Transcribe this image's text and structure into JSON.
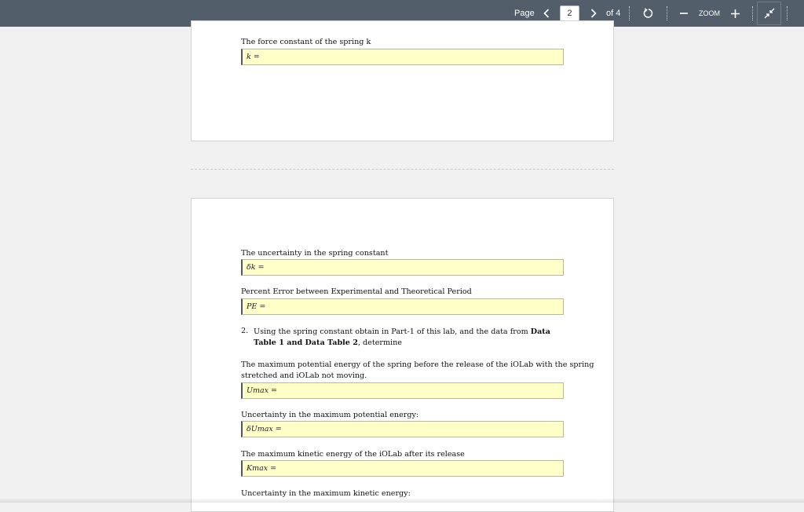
{
  "toolbar": {
    "page_label": "Page",
    "current_page": "2",
    "total_pages": "of 4",
    "zoom_label": "ZOOM",
    "icons": {
      "prev": "chevron-left-icon",
      "next": "chevron-right-icon",
      "rotate": "rotate-icon",
      "zoom_out": "minus-icon",
      "zoom_in": "plus-icon",
      "collapse": "collapse-icon"
    }
  },
  "page1": {
    "force_constant_label": "The force constant of the spring k",
    "force_constant_field": "k ="
  },
  "page2": {
    "uncertainty_label": "The uncertainty in the spring constant",
    "uncertainty_field": "δk =",
    "percent_error_label": "Percent Error between Experimental and Theoretical Period",
    "percent_error_field": "PE =",
    "item2_number": "2.",
    "item2_text_a": "Using the spring constant obtain in Part-1 of this lab, and the data from ",
    "item2_text_b": "Data Table 1 and Data Table 2",
    "item2_text_c": ", determine",
    "umax_label_1": "The maximum potential energy of the spring before the release of the iOLab with the spring",
    "umax_label_2": "stretched and iOLab not moving.",
    "umax_field": "Umax =",
    "dumax_label": "Uncertainty in the maximum potential energy:",
    "dumax_field": "δUmax =",
    "kmax_label": "The maximum kinetic energy of the iOLab after its release",
    "kmax_field": "Kmax =",
    "dkmax_label": "Uncertainty in the maximum kinetic energy:"
  },
  "colors": {
    "toolbar_bg": "#525e69",
    "field_bg": "#ffffc8",
    "viewer_bg": "#f1f1f1"
  }
}
